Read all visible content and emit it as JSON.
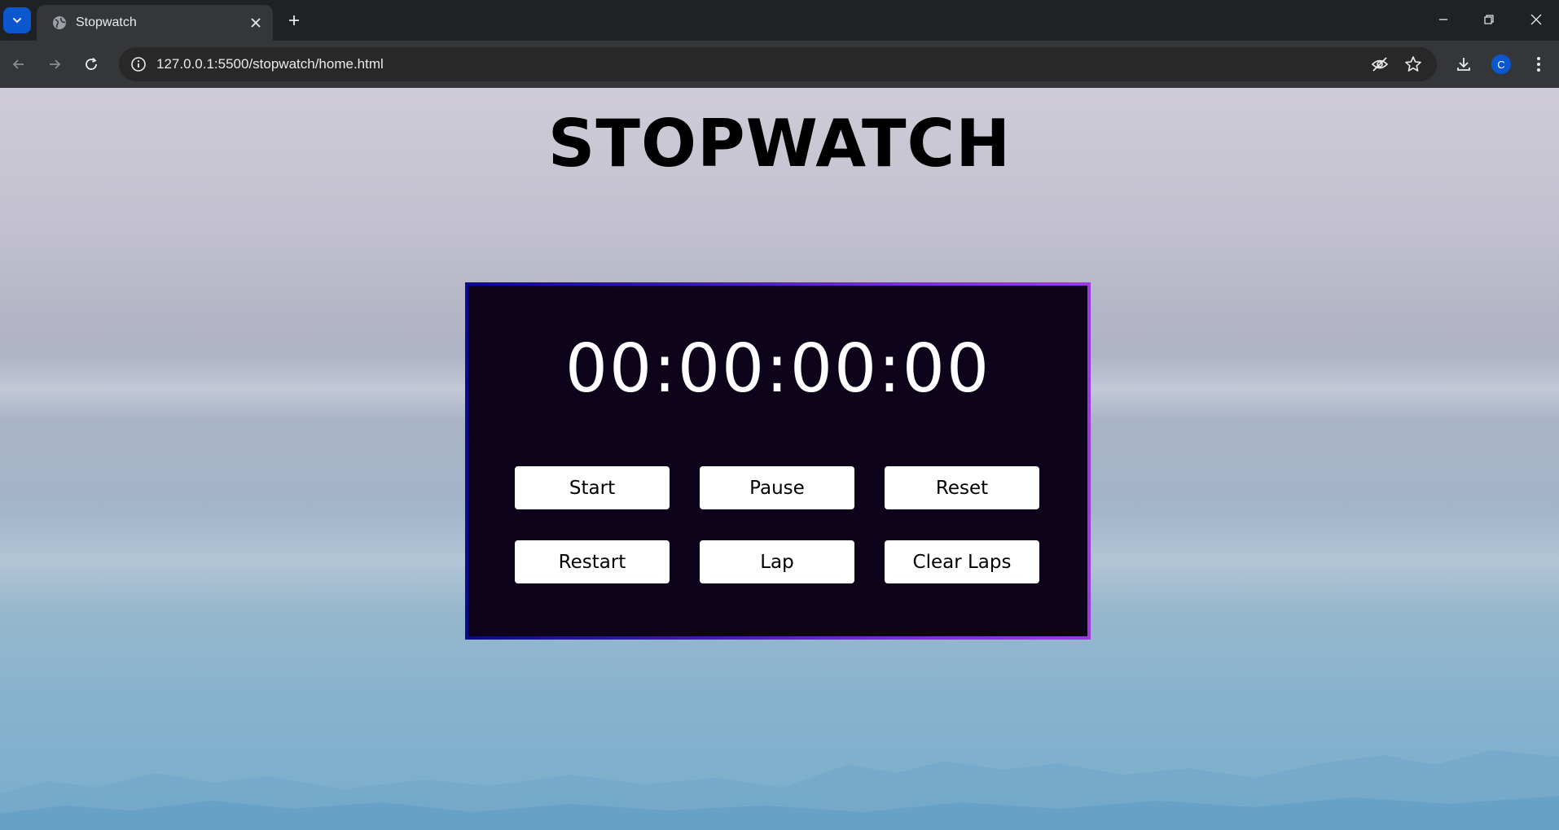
{
  "browser": {
    "tab_title": "Stopwatch",
    "url": "127.0.0.1:5500/stopwatch/home.html",
    "profile_initial": "C",
    "accent": "#0b57d0"
  },
  "page": {
    "heading": "STOPWATCH",
    "time": "00:00:00:00",
    "buttons": {
      "start": "Start",
      "pause": "Pause",
      "reset": "Reset",
      "restart": "Restart",
      "lap": "Lap",
      "clear_laps": "Clear Laps"
    },
    "colors": {
      "panel_bg": "#0d041c",
      "border_start": "#0b0a8c",
      "border_end": "#9b3be0",
      "button_bg": "#ffffff"
    }
  }
}
